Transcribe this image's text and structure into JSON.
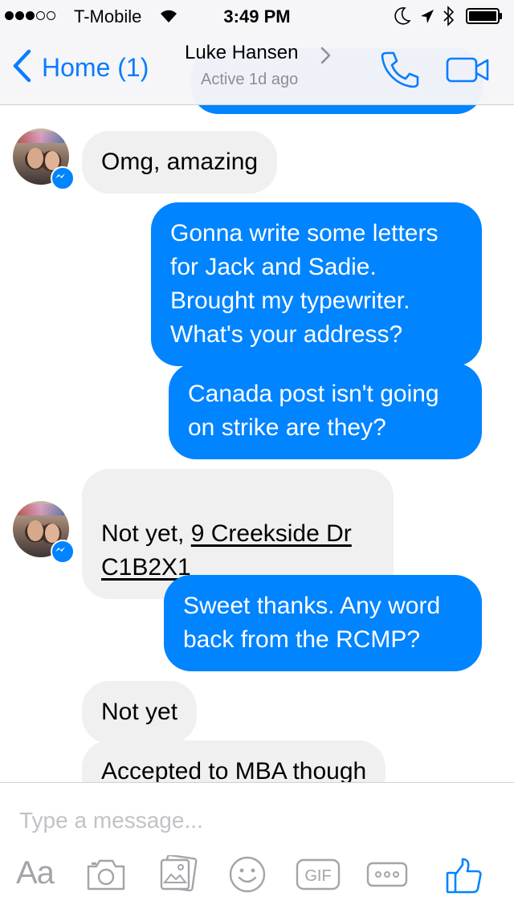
{
  "status_bar": {
    "carrier": "T-Mobile",
    "time": "3:49 PM",
    "signal_bars_filled": 3,
    "signal_bars_total": 5
  },
  "header": {
    "back_label": "Home (1)",
    "contact_name": "Luke Hansen",
    "contact_status": "Active 1d ago"
  },
  "messages": [
    {
      "sender": "contact",
      "text": "Omg, amazing"
    },
    {
      "sender": "me",
      "text": "Gonna write some letters\nfor Jack and Sadie.\nBrought my typewriter.\nWhat's your address?"
    },
    {
      "sender": "me",
      "text": "Canada post isn't going\non strike are they?"
    },
    {
      "sender": "contact",
      "text_prefix": "Not yet, ",
      "address_line1": "9 Creekside Dr",
      "address_line2": "C1B2X1"
    },
    {
      "sender": "me",
      "text": "Sweet thanks. Any word\nback from the RCMP?"
    },
    {
      "sender": "contact",
      "text": "Not yet"
    },
    {
      "sender": "contact",
      "text": "Accepted to MBA though"
    }
  ],
  "composer": {
    "placeholder": "Type a message...",
    "text_button_label": "Aa",
    "gif_label": "GIF"
  },
  "colors": {
    "accent": "#0084ff",
    "nav_tint": "#0a7cff",
    "incoming_bubble": "#f0f0f0",
    "icon_gray": "#a4a4aa"
  }
}
